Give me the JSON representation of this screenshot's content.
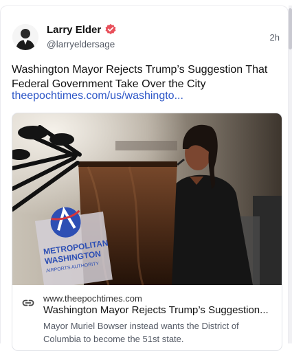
{
  "post": {
    "author_name": "Larry Elder",
    "author_handle": "@larryeldersage",
    "timestamp": "2h",
    "text": "Washington Mayor Rejects Trump’s Suggestion That Federal Government Take Over the City",
    "link_text": "theepochtimes.com/us/washingto..."
  },
  "link_preview": {
    "domain": "www.theepochtimes.com",
    "title": "Washington Mayor Rejects Trump’s Suggestion...",
    "description": "Mayor Muriel Bowser instead wants the District of Columbia to become the 51st state.",
    "image_sign_text": [
      "METROPOLITAN",
      "WASHINGTON",
      "AIRPORTS AUTHORITY"
    ]
  },
  "icons": {
    "verified": "verified-badge-icon",
    "link": "link-icon"
  },
  "colors": {
    "link": "#2c56c7",
    "verified": "#e8505b"
  }
}
